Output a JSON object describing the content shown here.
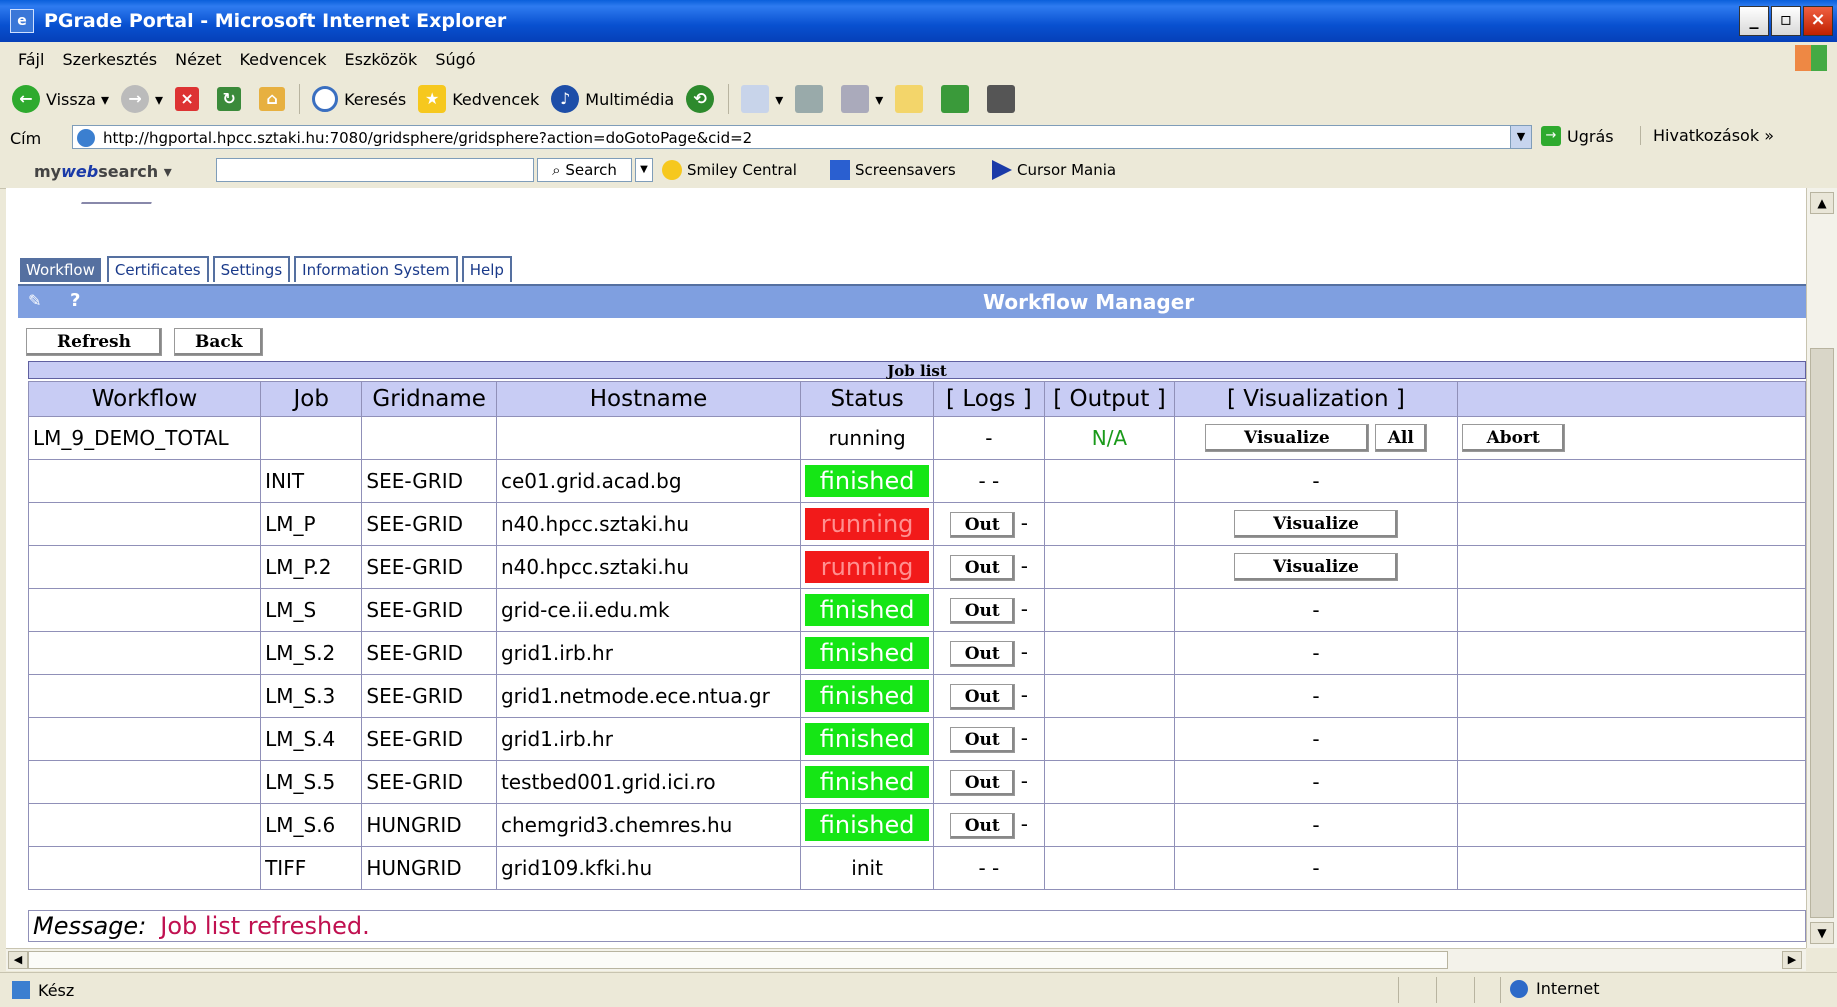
{
  "window": {
    "title": "PGrade Portal - Microsoft Internet Explorer"
  },
  "menu": [
    "Fájl",
    "Szerkesztés",
    "Nézet",
    "Kedvencek",
    "Eszközök",
    "Súgó"
  ],
  "toolbar": {
    "back": "Vissza",
    "search": "Keresés",
    "favorites": "Kedvencek",
    "media": "Multimédia"
  },
  "address": {
    "label": "Cím",
    "url": "http://hgportal.hpcc.sztaki.hu:7080/gridsphere/gridsphere?action=doGotoPage&cid=2",
    "go": "Ugrás",
    "links": "Hivatkozások »"
  },
  "websearch": {
    "brand_pre": "my",
    "brand_mid": "web",
    "brand_post": "search",
    "search_button": "Search",
    "items": [
      "Smiley Central",
      "Screensavers",
      "Cursor Mania"
    ]
  },
  "tabs": [
    "Workflow",
    "Certificates",
    "Settings",
    "Information System",
    "Help"
  ],
  "panel": {
    "title": "Workflow Manager",
    "help": "?",
    "refresh": "Refresh",
    "back": "Back",
    "joblist_title": "Job list"
  },
  "table": {
    "headers": [
      "Workflow",
      "Job",
      "Gridname",
      "Hostname",
      "Status",
      "[ Logs ]",
      "[ Output ]",
      "[ Visualization ]",
      ""
    ],
    "workflow_row": {
      "workflow": "LM_9_DEMO_TOTAL",
      "status": "running",
      "logs": "-",
      "output": "N/A",
      "visualize": "Visualize",
      "all": "All",
      "abort": "Abort"
    },
    "rows": [
      {
        "job": "INIT",
        "grid": "SEE-GRID",
        "host": "ce01.grid.acad.bg",
        "status": "finished",
        "state": "fin",
        "logs": "- -",
        "out": false,
        "vis": "-"
      },
      {
        "job": "LM_P",
        "grid": "SEE-GRID",
        "host": "n40.hpcc.sztaki.hu",
        "status": "running",
        "state": "run",
        "logs": "-",
        "out": true,
        "vis": "Visualize"
      },
      {
        "job": "LM_P.2",
        "grid": "SEE-GRID",
        "host": "n40.hpcc.sztaki.hu",
        "status": "running",
        "state": "run",
        "logs": "-",
        "out": true,
        "vis": "Visualize"
      },
      {
        "job": "LM_S",
        "grid": "SEE-GRID",
        "host": "grid-ce.ii.edu.mk",
        "status": "finished",
        "state": "fin",
        "logs": "-",
        "out": true,
        "vis": "-"
      },
      {
        "job": "LM_S.2",
        "grid": "SEE-GRID",
        "host": "grid1.irb.hr",
        "status": "finished",
        "state": "fin",
        "logs": "-",
        "out": true,
        "vis": "-"
      },
      {
        "job": "LM_S.3",
        "grid": "SEE-GRID",
        "host": "grid1.netmode.ece.ntua.gr",
        "status": "finished",
        "state": "fin",
        "logs": "-",
        "out": true,
        "vis": "-"
      },
      {
        "job": "LM_S.4",
        "grid": "SEE-GRID",
        "host": "grid1.irb.hr",
        "status": "finished",
        "state": "fin",
        "logs": "-",
        "out": true,
        "vis": "-"
      },
      {
        "job": "LM_S.5",
        "grid": "SEE-GRID",
        "host": "testbed001.grid.ici.ro",
        "status": "finished",
        "state": "fin",
        "logs": "-",
        "out": true,
        "vis": "-"
      },
      {
        "job": "LM_S.6",
        "grid": "HUNGRID",
        "host": "chemgrid3.chemres.hu",
        "status": "finished",
        "state": "fin",
        "logs": "-",
        "out": true,
        "vis": "-"
      },
      {
        "job": "TIFF",
        "grid": "HUNGRID",
        "host": "grid109.kfki.hu",
        "status": "init",
        "state": "init",
        "logs": "- -",
        "out": false,
        "vis": "-"
      }
    ],
    "out_label": "Out"
  },
  "message": {
    "label": "Message:",
    "text": "Job list refreshed."
  },
  "status": {
    "left": "Kész",
    "zone": "Internet"
  }
}
